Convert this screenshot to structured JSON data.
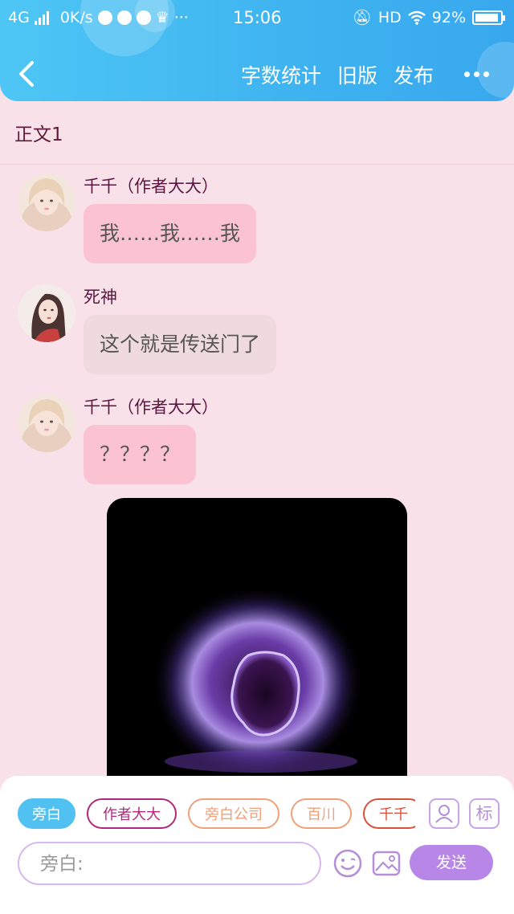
{
  "status_bar": {
    "network": "4G",
    "speed": "0K/s",
    "time": "15:06",
    "hd": "HD",
    "battery": "92%",
    "battery_level": 0.92
  },
  "nav": {
    "back_icon": "chevron-left-icon",
    "word_count": "字数统计",
    "old_version": "旧版",
    "publish": "发布",
    "more_icon": "more-dots-icon"
  },
  "chapter": {
    "title": "正文1"
  },
  "messages": [
    {
      "name": "千千（作者大大）",
      "text": "我……我……我",
      "avatar": "avatar-qianqian"
    },
    {
      "name": "死神",
      "text": "这个就是传送门了",
      "avatar": "avatar-sishen"
    },
    {
      "name": "千千（作者大大）",
      "text": "？？？？",
      "avatar": "avatar-qianqian"
    }
  ],
  "image": {
    "content": "purple-portal-image"
  },
  "roles": [
    {
      "label": "旁白",
      "color": "#51c1f1"
    },
    {
      "label": "作者大大",
      "color": "#b0287a"
    },
    {
      "label": "旁白公司",
      "color": "#f0a07a"
    },
    {
      "label": "百川",
      "color": "#f0a07a"
    },
    {
      "label": "千千",
      "color": "#d9503c"
    }
  ],
  "tools": {
    "role_icon": "person-card-icon",
    "tag_label": "标"
  },
  "composer": {
    "placeholder": "旁白:",
    "emoji_icon": "smiley-icon",
    "image_icon": "image-icon",
    "send_label": "发送"
  },
  "colors": {
    "header": "#3fb4f0",
    "page_bg": "#f9e1ea",
    "bubble_pink": "#fbc3d2",
    "bubble_grey": "#efdbdf",
    "send_button": "#b786e6"
  }
}
